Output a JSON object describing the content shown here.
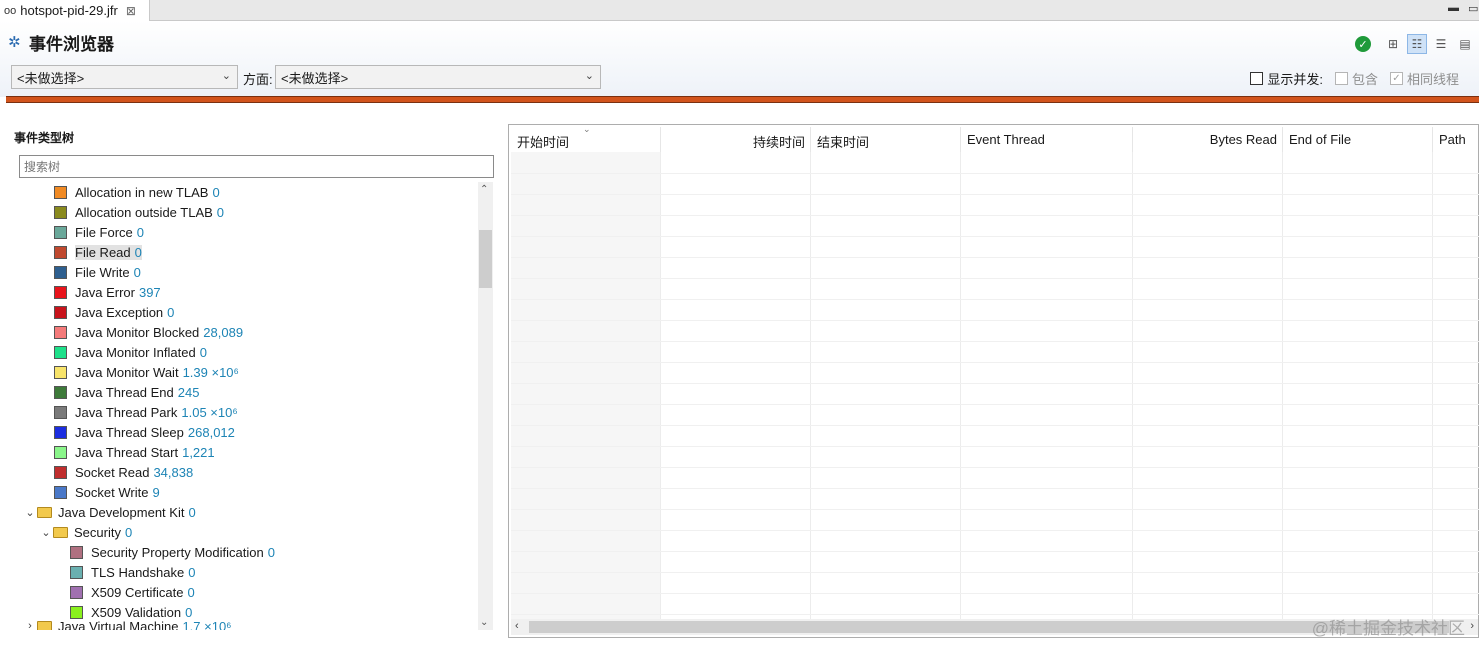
{
  "tab": {
    "title": "hotspot-pid-29.jfr",
    "icon": "recording-icon",
    "close": "⊠"
  },
  "window_controls": {
    "minimize": "▬",
    "maximize": "▭"
  },
  "header": {
    "title": "事件浏览器",
    "type_combo": "<未做选择>",
    "aspect_label": "方面:",
    "aspect_combo": "<未做选择>",
    "show_concurrent": "显示并发:",
    "contains": "包含",
    "same_thread": "相同线程"
  },
  "tree_panel": {
    "title": "事件类型树",
    "search_placeholder": "搜索树",
    "items": [
      {
        "label": "Allocation in new TLAB",
        "count": "0",
        "color": "#f08a24"
      },
      {
        "label": "Allocation outside TLAB",
        "count": "0",
        "color": "#8a8a1e"
      },
      {
        "label": "File Force",
        "count": "0",
        "color": "#6aa89a"
      },
      {
        "label": "File Read",
        "count": "0",
        "color": "#c0492f",
        "selected": true
      },
      {
        "label": "File Write",
        "count": "0",
        "color": "#2e5f8f"
      },
      {
        "label": "Java Error",
        "count": "397",
        "color": "#e8141c"
      },
      {
        "label": "Java Exception",
        "count": "0",
        "color": "#c8141c"
      },
      {
        "label": "Java Monitor Blocked",
        "count": "28,089",
        "color": "#f47a7a"
      },
      {
        "label": "Java Monitor Inflated",
        "count": "0",
        "color": "#1ee08a"
      },
      {
        "label": "Java Monitor Wait",
        "count": "1.39 ×10⁶",
        "color": "#f7e36a"
      },
      {
        "label": "Java Thread End",
        "count": "245",
        "color": "#3e7a3a"
      },
      {
        "label": "Java Thread Park",
        "count": "1.05 ×10⁶",
        "color": "#7a7a7a"
      },
      {
        "label": "Java Thread Sleep",
        "count": "268,012",
        "color": "#1c2ee0"
      },
      {
        "label": "Java Thread Start",
        "count": "1,221",
        "color": "#8af58a"
      },
      {
        "label": "Socket Read",
        "count": "34,838",
        "color": "#c02e2e"
      },
      {
        "label": "Socket Write",
        "count": "9",
        "color": "#4a78c8"
      }
    ],
    "folder_jdk": {
      "label": "Java Development Kit",
      "count": "0"
    },
    "folder_security": {
      "label": "Security",
      "count": "0"
    },
    "security_items": [
      {
        "label": "Security Property Modification",
        "count": "0",
        "color": "#b07080"
      },
      {
        "label": "TLS Handshake",
        "count": "0",
        "color": "#6ab0b0"
      },
      {
        "label": "X509 Certificate",
        "count": "0",
        "color": "#a070b0"
      },
      {
        "label": "X509 Validation",
        "count": "0",
        "color": "#8af01e"
      }
    ],
    "partial_row": {
      "label": "Java Virtual Machine",
      "count": "1.7 ×10⁶"
    }
  },
  "table": {
    "columns": [
      "开始时间",
      "持续时间",
      "结束时间",
      "Event Thread",
      "Bytes Read",
      "End of File",
      "Path"
    ]
  },
  "watermark": "@稀土掘金技术社区"
}
